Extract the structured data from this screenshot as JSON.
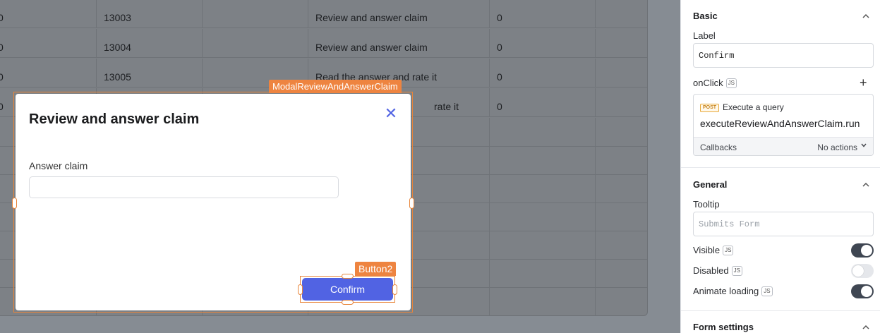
{
  "table": {
    "rows": [
      {
        "c0": "0",
        "c1": "13003",
        "c2": "",
        "c3": "Review and answer claim",
        "c4": "0"
      },
      {
        "c0": "0",
        "c1": "13004",
        "c2": "",
        "c3": "Review and answer claim",
        "c4": "0"
      },
      {
        "c0": "0",
        "c1": "13005",
        "c2": "",
        "c3": "Read the answer and rate it",
        "c4": "0"
      },
      {
        "c0": "0",
        "c1": "",
        "c2": "",
        "c3": "rate it",
        "c4": "0"
      }
    ]
  },
  "modal": {
    "tag": "ModalReviewAndAnswerClaim",
    "title": "Review and answer claim",
    "close_icon": "close-icon",
    "answer_label": "Answer claim",
    "answer_value": "",
    "button_tag": "Button2",
    "confirm_label": "Confirm"
  },
  "panel": {
    "basic": {
      "title": "Basic",
      "label_title": "Label",
      "label_value": "Confirm",
      "onclick_title": "onClick",
      "js": "JS",
      "action_method": "POST",
      "action_title": "Execute a query",
      "action_query": "executeReviewAndAnswerClaim.run",
      "callbacks_label": "Callbacks",
      "callbacks_value": "No actions"
    },
    "general": {
      "title": "General",
      "tooltip_title": "Tooltip",
      "tooltip_placeholder": "Submits Form",
      "visible_label": "Visible",
      "visible": true,
      "disabled_label": "Disabled",
      "disabled": false,
      "animate_label": "Animate loading",
      "animate": true
    },
    "form_settings": {
      "title": "Form settings"
    }
  },
  "colors": {
    "accent": "#5163e3",
    "selection": "#ee8440",
    "toggle_on": "#3f4652",
    "overlay": "#868c93"
  }
}
